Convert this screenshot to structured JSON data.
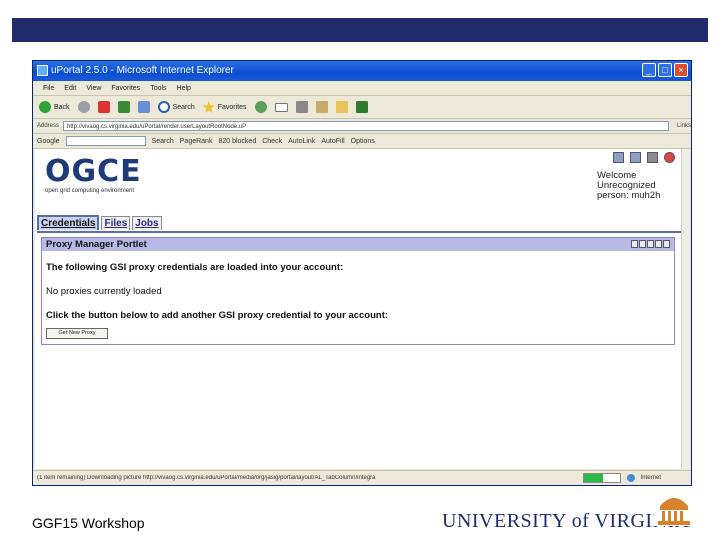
{
  "window": {
    "title": "uPortal 2.5.0 - Microsoft Internet Explorer",
    "controls": {
      "minimize": "_",
      "maximize": "□",
      "close": "×"
    }
  },
  "menu": [
    "File",
    "Edit",
    "View",
    "Favorites",
    "Tools",
    "Help"
  ],
  "toolbar": {
    "back_label": "Back",
    "search_label": "Search",
    "favorites_label": "Favorites"
  },
  "address": {
    "label": "Address",
    "url": "http://vivaog.cs.virginia.edu/uPortal/render.userLayoutRootNode.uP",
    "links": "Links"
  },
  "google_bar": {
    "label": "Google",
    "search": "Search",
    "pagerank": "PageRank",
    "blocked": "820 blocked",
    "check": "Check",
    "autolink": "AutoLink",
    "autofill": "AutoFill",
    "options": "Options"
  },
  "portal": {
    "logo_title": "OGCE",
    "logo_subtitle": "open grid computing environment",
    "welcome": "Welcome Unrecognized person: muh2h",
    "tabs": [
      "Credentials",
      "Files",
      "Jobs"
    ],
    "active_tab": "Credentials"
  },
  "portlet": {
    "title": "Proxy Manager Portlet",
    "line1": "The following GSI proxy credentials are loaded into your account:",
    "line2": "No proxies currently loaded",
    "line3": "Click the button below to add another GSI proxy credential to your account:",
    "button_label": "Get New Proxy"
  },
  "status": {
    "text": "(1 item remaining) Downloading picture http://vivaog.cs.virginia.edu/uPortal/media/org/jasig/portal/layout/AL_TabColumn/integra",
    "zone": "Internet",
    "progress": 0.55
  },
  "slide": {
    "footer_text": "GGF15 Workshop",
    "university": "UNIVERSITY of VIRGINIA"
  },
  "colors": {
    "slide_band": "#1f2b6b",
    "portlet_header": "#b8b8e6",
    "logo": "#1f3a78"
  }
}
